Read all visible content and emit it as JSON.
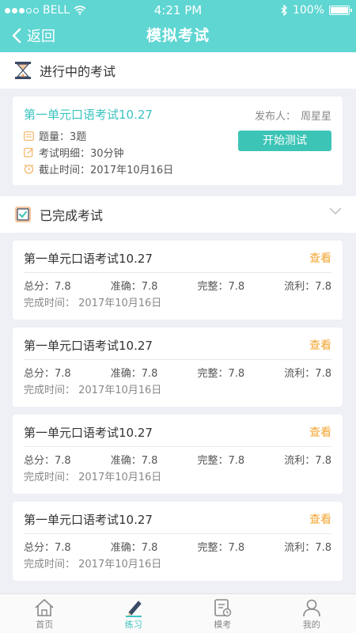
{
  "status_bar": {
    "carrier": "BELL",
    "time": "4:21 PM",
    "battery": "100%"
  },
  "nav": {
    "back_label": "返回",
    "title": "模拟考试"
  },
  "ongoing_section": {
    "title": "进行中的考试"
  },
  "ongoing_exam": {
    "title": "第一单元口语考试10.27",
    "publisher_label": "发布人：",
    "publisher": "周星星",
    "question_count": "题量：3题",
    "details": "考试明细：30分钟",
    "deadline": "截止时间：2017年10月16日",
    "start_label": "开始测试"
  },
  "completed_section": {
    "title": "已完成考试"
  },
  "completed_exams": [
    {
      "title": "第一单元口语考试10.27",
      "view_label": "查看",
      "total": "总分：7.8",
      "accuracy": "准确：7.8",
      "completeness": "完整：7.8",
      "fluency": "流利：7.8",
      "finish_time": "完成时间：  2017年10月16日"
    },
    {
      "title": "第一单元口语考试10.27",
      "view_label": "查看",
      "total": "总分：7.8",
      "accuracy": "准确：7.8",
      "completeness": "完整：7.8",
      "fluency": "流利：7.8",
      "finish_time": "完成时间：  2017年10月16日"
    },
    {
      "title": "第一单元口语考试10.27",
      "view_label": "查看",
      "total": "总分：7.8",
      "accuracy": "准确：7.8",
      "completeness": "完整：7.8",
      "fluency": "流利：7.8",
      "finish_time": "完成时间：  2017年10月16日"
    },
    {
      "title": "第一单元口语考试10.27",
      "view_label": "查看",
      "total": "总分：7.8",
      "accuracy": "准确：7.8",
      "completeness": "完整：7.8",
      "fluency": "流利：7.8",
      "finish_time": "完成时间：  2017年10月16日"
    }
  ],
  "tabs": [
    {
      "label": "首页",
      "icon": "home-icon"
    },
    {
      "label": "练习",
      "icon": "pencil-icon"
    },
    {
      "label": "模考",
      "icon": "exam-icon"
    },
    {
      "label": "我的",
      "icon": "user-icon"
    }
  ],
  "colors": {
    "accent": "#5fd6d2",
    "button": "#3cc4b6",
    "view_link": "#f3a530",
    "active_tab": "#3cc4c0"
  }
}
